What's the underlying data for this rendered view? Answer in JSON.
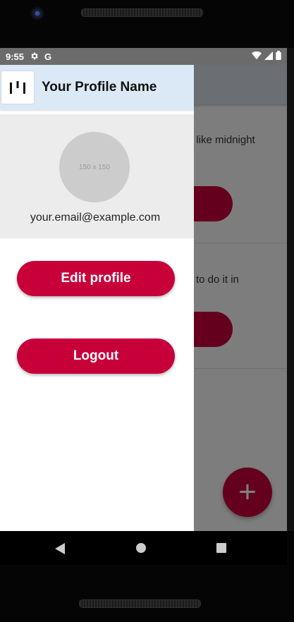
{
  "status_bar": {
    "time": "9:55",
    "icons_left": [
      "settings-gear",
      "google-g"
    ],
    "icons_right": [
      "wifi",
      "signal",
      "battery"
    ],
    "g_glyph": "G"
  },
  "background_app": {
    "item1_text": "t like midnight",
    "item2_text": "to do it in",
    "fab_glyph": "+"
  },
  "drawer": {
    "title": "Your Profile Name",
    "avatar_placeholder": "150 x 150",
    "email": "your.email@example.com",
    "edit_profile_label": "Edit profile",
    "logout_label": "Logout"
  },
  "colors": {
    "accent": "#c8003a",
    "header_bg": "#dbe9f6",
    "profile_bg": "#ececec"
  }
}
